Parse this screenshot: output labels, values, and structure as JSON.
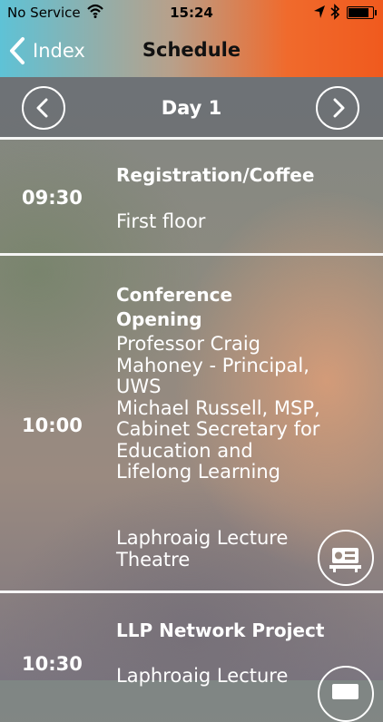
{
  "status_bar": {
    "carrier": "No Service",
    "time": "15:24"
  },
  "nav": {
    "back_label": "Index",
    "title": "Schedule"
  },
  "day_selector": {
    "label": "Day 1"
  },
  "sessions": [
    {
      "time": "09:30",
      "title": "Registration/Coffee",
      "speakers": "",
      "location": "First floor"
    },
    {
      "time": "10:00",
      "title": "Conference Opening",
      "speakers": "Professor Craig Mahoney - Principal, UWS\nMichael Russell, MSP, Cabinet Secretary for Education and Lifelong Learning",
      "location": "Laphroaig Lecture Theatre"
    },
    {
      "time": "10:30",
      "title": "LLP Network Project",
      "speakers": "",
      "location": "Laphroaig Lecture"
    }
  ],
  "icons": {
    "back": "chevron-left-icon",
    "prev": "chevron-left-icon",
    "next": "chevron-right-icon",
    "location": "projector-icon"
  },
  "colors": {
    "header_gradient_start": "#5ec2d6",
    "header_gradient_end": "#f05a1e",
    "title_text": "#111111",
    "text": "#ffffff"
  }
}
